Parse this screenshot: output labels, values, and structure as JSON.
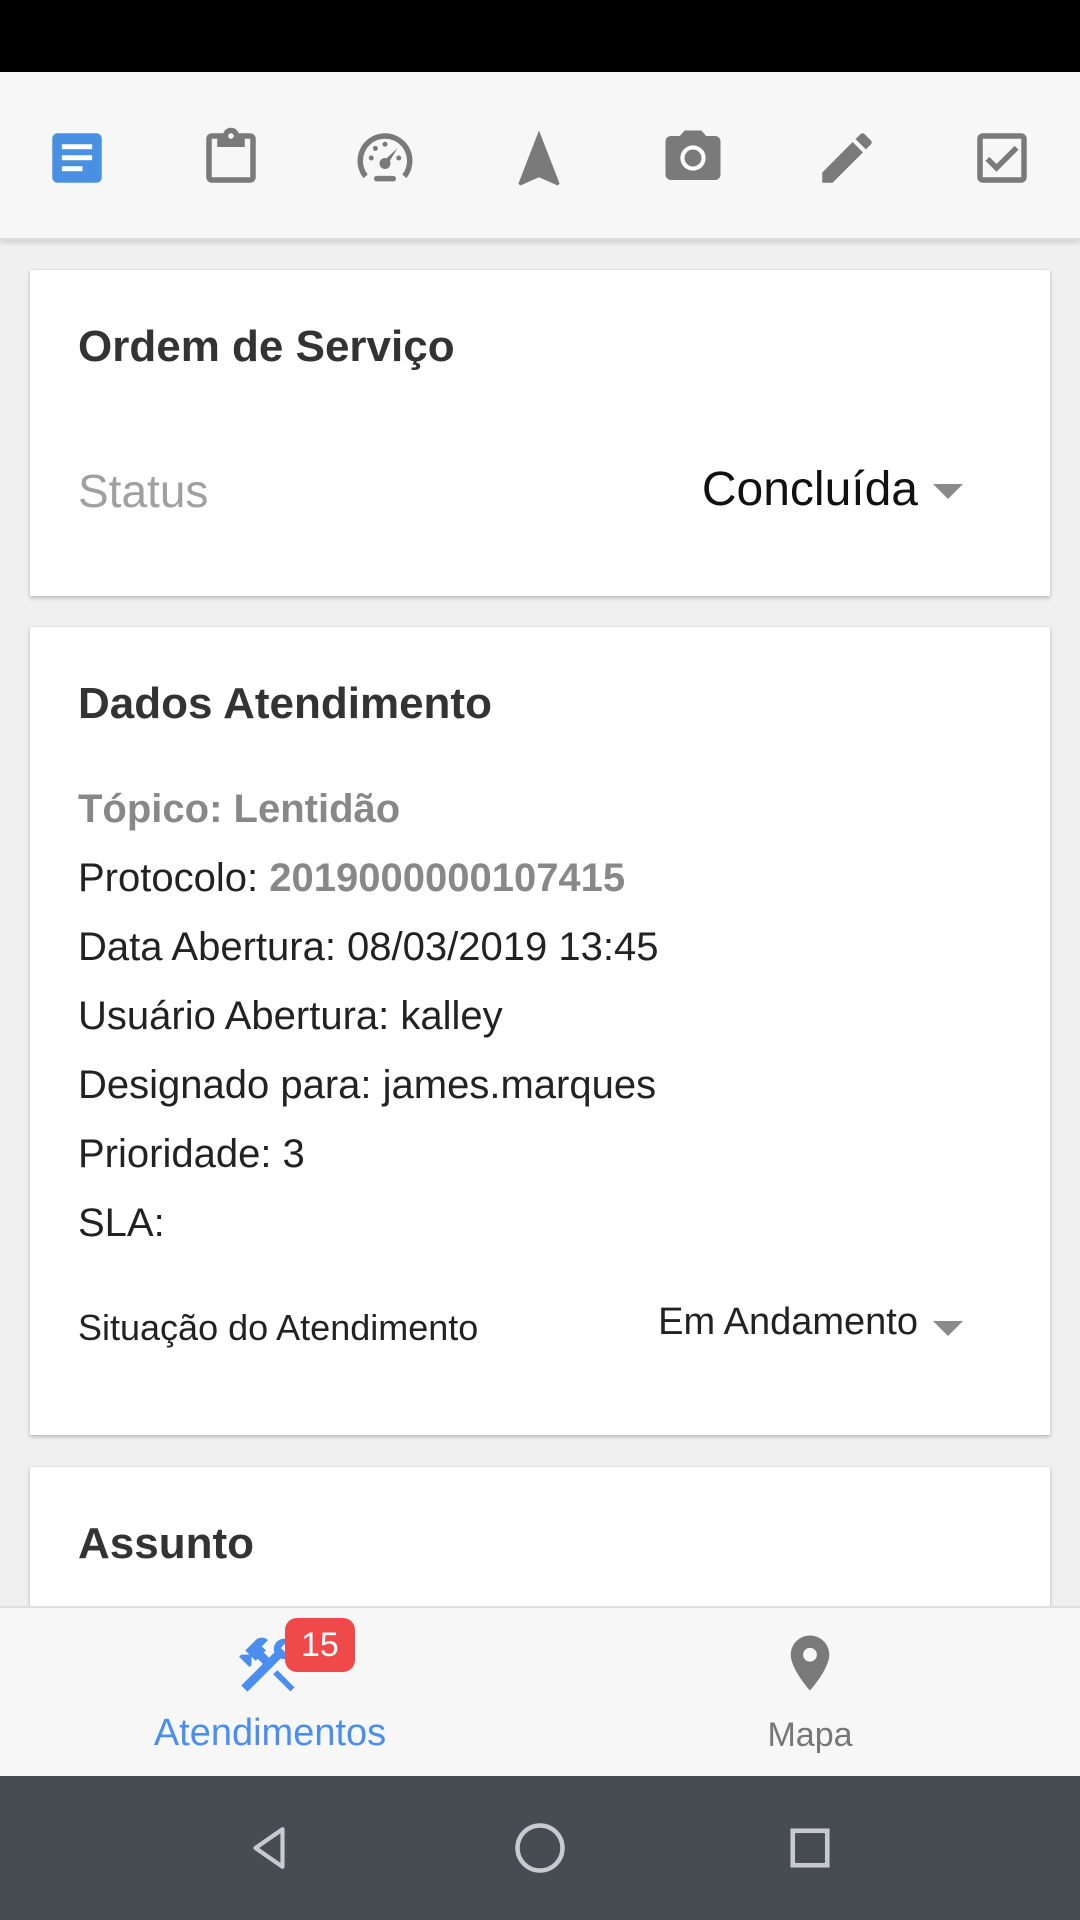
{
  "toolbar": {
    "icons": [
      "document-icon",
      "clipboard-icon",
      "speedometer-icon",
      "navigation-icon",
      "camera-icon",
      "edit-icon",
      "checkbox-icon"
    ],
    "active_color": "#4a90e2",
    "icon_color": "#7a7a7a"
  },
  "ordem": {
    "title": "Ordem de Serviço",
    "status_label": "Status",
    "status_value": "Concluída"
  },
  "dados": {
    "title": "Dados Atendimento",
    "topico_label": "Tópico:",
    "topico_value": "Lentidão",
    "protocolo_label": "Protocolo:",
    "protocolo_value": "2019000000107415",
    "data_abertura": "Data Abertura: 08/03/2019 13:45",
    "usuario_abertura": "Usuário Abertura: kalley",
    "designado": "Designado para: james.marques",
    "prioridade": "Prioridade: 3",
    "sla": "SLA:",
    "situacao_label": "Situação do Atendimento",
    "situacao_value": "Em Andamento"
  },
  "assunto": {
    "title": "Assunto"
  },
  "bottom_nav": {
    "atendimentos_label": "Atendimentos",
    "atendimentos_badge": "15",
    "mapa_label": "Mapa",
    "active_color": "#4a8ff0",
    "badge_color": "#f0494a"
  },
  "system_nav": {
    "icons": [
      "back-icon",
      "home-icon",
      "recents-icon"
    ]
  }
}
